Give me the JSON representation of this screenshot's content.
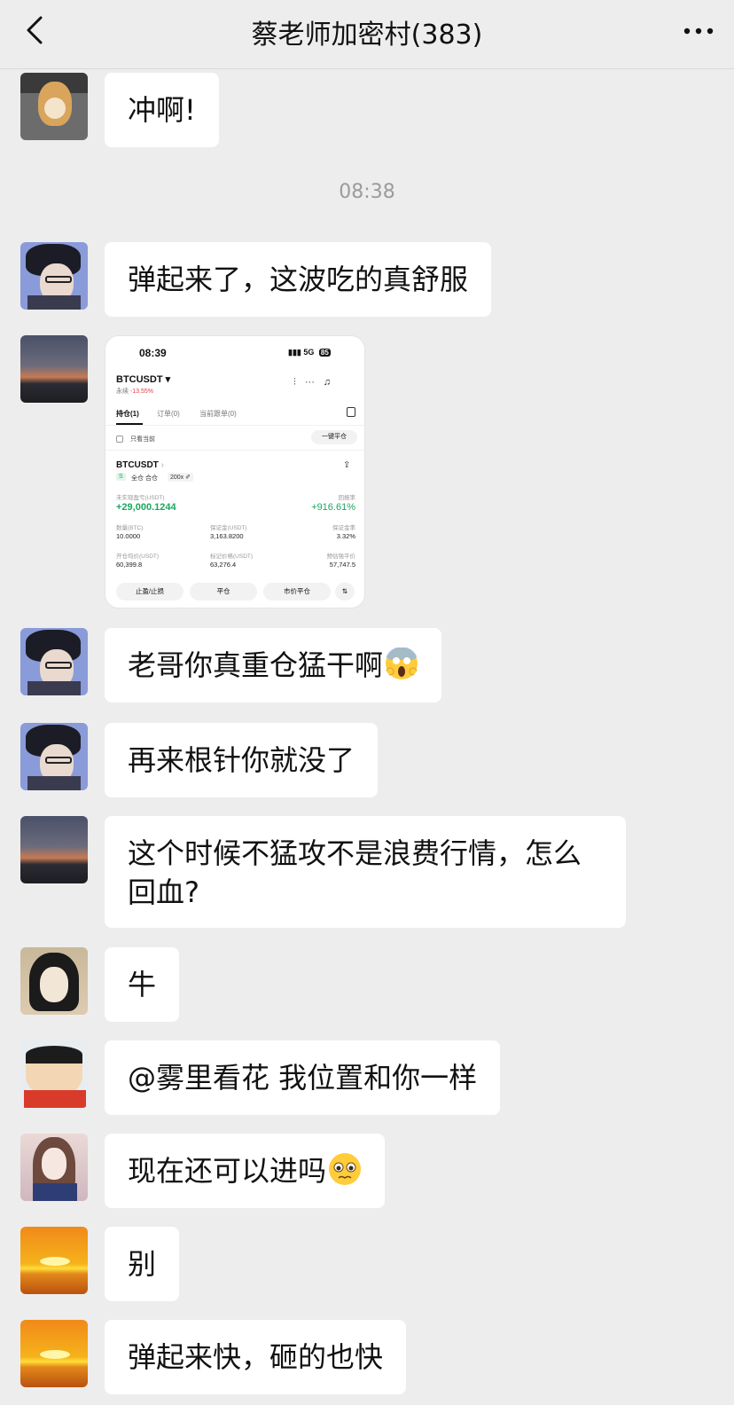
{
  "header": {
    "title": "蔡老师加密村(383)",
    "back_icon": "chevron-left-icon",
    "more_icon": "more-dots-icon"
  },
  "timestamp": "08:38",
  "messages": [
    {
      "avatar": "shiba-dog-avatar",
      "text": "冲啊!"
    },
    {
      "avatar": "anime-man-glasses-avatar",
      "text": "弹起来了，这波吃的真舒服"
    },
    {
      "avatar": "sunset-landscape-avatar",
      "type": "image"
    },
    {
      "avatar": "anime-man-glasses-avatar",
      "text": "老哥你真重仓猛干啊",
      "emoji": "screaming-face-emoji"
    },
    {
      "avatar": "anime-man-glasses-avatar",
      "text": "再来根针你就没了"
    },
    {
      "avatar": "sunset-landscape-avatar",
      "text": "这个时候不猛攻不是浪费行情，怎么回血?"
    },
    {
      "avatar": "anime-girl-avatar",
      "text": "牛"
    },
    {
      "avatar": "crayon-shin-chan-avatar",
      "text": "@雾里看花 我位置和你一样"
    },
    {
      "avatar": "illustrated-woman-avatar",
      "text": "现在还可以进吗",
      "emoji": "pleading-face-emoji"
    },
    {
      "avatar": "orange-sunset-avatar",
      "text": "别"
    },
    {
      "avatar": "orange-sunset-avatar",
      "text": "弹起来快，砸的也快"
    }
  ],
  "screenshot": {
    "time": "08:39",
    "network": "5G",
    "battery": "85",
    "symbol": "BTCUSDT",
    "sub_label": "永续",
    "sub_change": "-13.55%",
    "tabs": [
      "持仓(1)",
      "订单(0)",
      "当前跟单(0)"
    ],
    "only_current": "只看当前",
    "close_all": "一键平仓",
    "position": {
      "symbol": "BTCUSDT",
      "tags": [
        "S",
        "全仓 合仓",
        "200x ✐"
      ],
      "pnl_label": "未实现盈亏(USDT)",
      "pnl_value": "+29,000.1244",
      "roe_label": "回报率",
      "roe_value": "+916.61%",
      "qty_label": "数量(BTC)",
      "qty_value": "10.0000",
      "margin_label": "保证金(USDT)",
      "margin_value": "3,163.8200",
      "margin_ratio_label": "保证金率",
      "margin_ratio_value": "3.32%",
      "entry_label": "开仓均价(USDT)",
      "entry_value": "60,399.8",
      "mark_label": "标记价格(USDT)",
      "mark_value": "63,276.4",
      "liq_label": "预估强平价",
      "liq_value": "57,747.5"
    },
    "buttons": [
      "止盈/止损",
      "平仓",
      "市价平仓",
      "⇅"
    ]
  },
  "colors": {
    "background": "#ededed",
    "bubble": "#ffffff",
    "profit_green": "#1aa760",
    "loss_red": "#e0404a"
  }
}
